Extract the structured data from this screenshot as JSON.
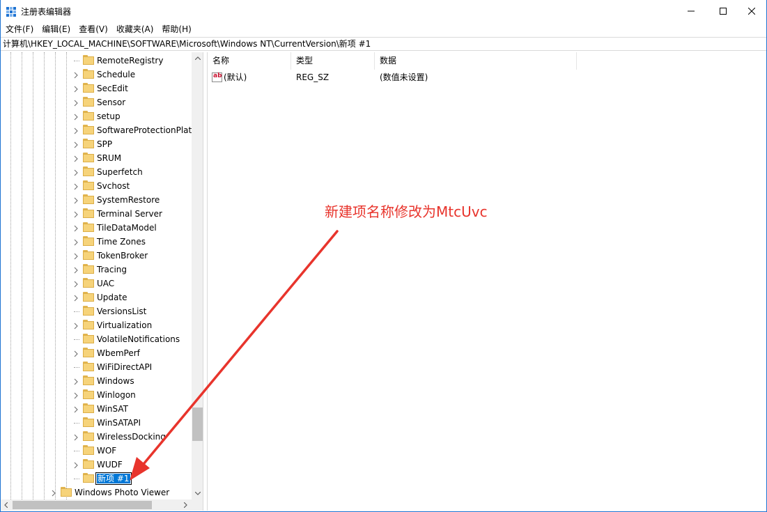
{
  "window": {
    "title": "注册表编辑器",
    "accent": "#1e73d2"
  },
  "menu": [
    {
      "label": "文件(F)"
    },
    {
      "label": "编辑(E)"
    },
    {
      "label": "查看(V)"
    },
    {
      "label": "收藏夹(A)"
    },
    {
      "label": "帮助(H)"
    }
  ],
  "address": "计算机\\HKEY_LOCAL_MACHINE\\SOFTWARE\\Microsoft\\Windows NT\\CurrentVersion\\新项 #1",
  "tree": {
    "items": [
      {
        "label": "RemoteRegistry",
        "expandable": false
      },
      {
        "label": "Schedule",
        "expandable": true
      },
      {
        "label": "SecEdit",
        "expandable": true
      },
      {
        "label": "Sensor",
        "expandable": true
      },
      {
        "label": "setup",
        "expandable": true
      },
      {
        "label": "SoftwareProtectionPlatf",
        "expandable": true
      },
      {
        "label": "SPP",
        "expandable": true
      },
      {
        "label": "SRUM",
        "expandable": true
      },
      {
        "label": "Superfetch",
        "expandable": true
      },
      {
        "label": "Svchost",
        "expandable": true
      },
      {
        "label": "SystemRestore",
        "expandable": true
      },
      {
        "label": "Terminal Server",
        "expandable": true
      },
      {
        "label": "TileDataModel",
        "expandable": true
      },
      {
        "label": "Time Zones",
        "expandable": true
      },
      {
        "label": "TokenBroker",
        "expandable": true
      },
      {
        "label": "Tracing",
        "expandable": true
      },
      {
        "label": "UAC",
        "expandable": true
      },
      {
        "label": "Update",
        "expandable": true
      },
      {
        "label": "VersionsList",
        "expandable": false
      },
      {
        "label": "Virtualization",
        "expandable": true
      },
      {
        "label": "VolatileNotifications",
        "expandable": false
      },
      {
        "label": "WbemPerf",
        "expandable": true
      },
      {
        "label": "WiFiDirectAPI",
        "expandable": false
      },
      {
        "label": "Windows",
        "expandable": true
      },
      {
        "label": "Winlogon",
        "expandable": true
      },
      {
        "label": "WinSAT",
        "expandable": true
      },
      {
        "label": "WinSATAPI",
        "expandable": false
      },
      {
        "label": "WirelessDocking",
        "expandable": true
      },
      {
        "label": "WOF",
        "expandable": false
      },
      {
        "label": "WUDF",
        "expandable": true
      }
    ],
    "editing_item": "新项 #1",
    "parent_sibling": "Windows Photo Viewer"
  },
  "list": {
    "columns": [
      "名称",
      "类型",
      "数据"
    ],
    "rows": [
      {
        "name": "(默认)",
        "type": "REG_SZ",
        "data": "(数值未设置)",
        "icon": "string-value-icon"
      }
    ]
  },
  "annotation": {
    "text": "新建项名称修改为MtcUvc",
    "color": "#e8342c"
  }
}
